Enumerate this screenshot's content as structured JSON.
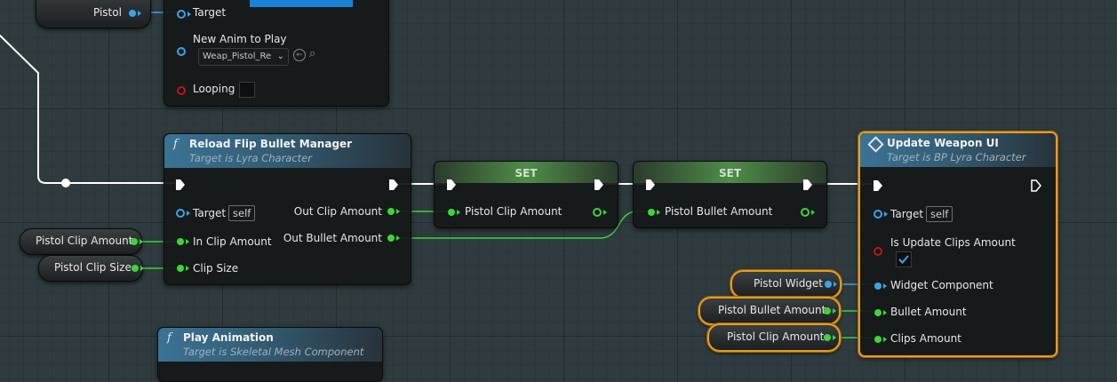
{
  "colors": {
    "exec": "#ffffff",
    "float": "#3fd43a",
    "object": "#3ba3e6",
    "bool": "#b81818",
    "selected": "#e89d1c"
  },
  "top_pistol_var": {
    "label": "Pistol"
  },
  "play_anim_top": {
    "target_label": "Target",
    "new_anim_label": "New Anim to Play",
    "anim_value": "Weap_Pistol_Re",
    "looping_label": "Looping"
  },
  "reload_node": {
    "title": "Reload Flip Bullet Manager",
    "subtitle": "Target is Lyra Character",
    "target_label": "Target",
    "self_label": "self",
    "in_clip_label": "In Clip Amount",
    "clip_size_label": "Clip Size",
    "out_clip_label": "Out Clip Amount",
    "out_bullet_label": "Out Bullet Amount"
  },
  "set_node_1": {
    "title": "SET",
    "var_label": "Pistol Clip Amount"
  },
  "set_node_2": {
    "title": "SET",
    "var_label": "Pistol Bullet Amount"
  },
  "update_node": {
    "title": "Update Weapon UI",
    "subtitle": "Target is BP Lyra Character",
    "target_label": "Target",
    "self_label": "self",
    "is_update_label": "Is Update Clips Amount",
    "is_update_checked": true,
    "widget_label": "Widget Component",
    "bullet_label": "Bullet Amount",
    "clips_label": "Clips Amount"
  },
  "vars": {
    "pistol_clip_amount": "Pistol Clip Amount",
    "pistol_clip_size": "Pistol Clip Size",
    "pistol_widget": "Pistol Widget",
    "pistol_bullet_amount": "Pistol Bullet Amount",
    "pistol_clip_amount_2": "Pistol Clip Amount"
  },
  "play_anim_bottom": {
    "title": "Play Animation",
    "subtitle": "Target is Skeletal Mesh Component"
  }
}
